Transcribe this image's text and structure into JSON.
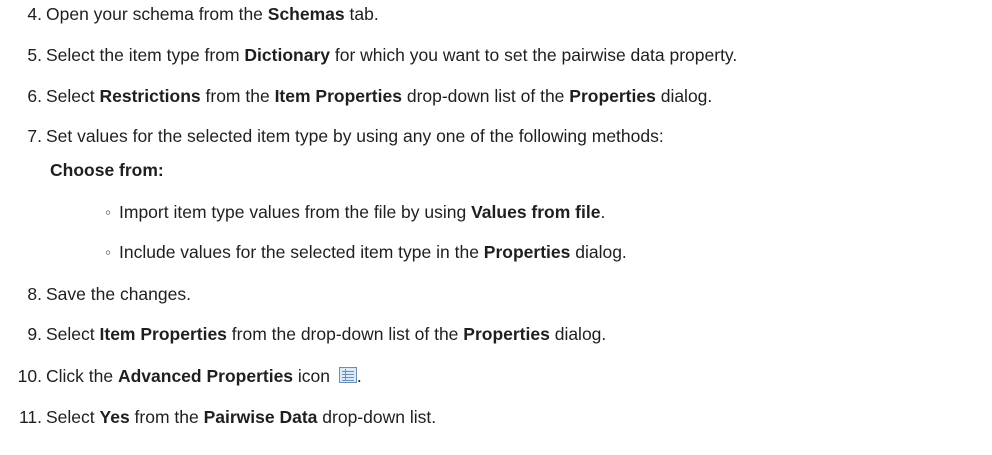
{
  "steps": [
    {
      "num": "4.",
      "t1": "Open your schema from the ",
      "b1": "Schemas",
      "t2": " tab."
    },
    {
      "num": "5.",
      "t1": "Select the item type from ",
      "b1": "Dictionary",
      "t2": " for which you want to set the pairwise data property."
    },
    {
      "num": "6.",
      "t1": "Select ",
      "b1": "Restrictions",
      "t2": " from the ",
      "b2": "Item Properties",
      "t3": " drop-down list of the ",
      "b3": "Properties",
      "t4": " dialog."
    },
    {
      "num": "7.",
      "t1": "Set values for the selected item type by using any one of the following methods:"
    },
    {
      "num": "8.",
      "t1": "Save the changes."
    },
    {
      "num": "9.",
      "t1": "Select ",
      "b1": "Item Properties",
      "t2": " from the drop-down list of the ",
      "b2": "Properties",
      "t3": " dialog."
    },
    {
      "num": "10.",
      "t1": "Click the ",
      "b1": "Advanced Properties",
      "t2": " icon ",
      "t3": "."
    },
    {
      "num": "11.",
      "t1": "Select ",
      "b1": "Yes",
      "t2": " from the ",
      "b2": "Pairwise Data",
      "t3": " drop-down list."
    }
  ],
  "choose_from": "Choose from:",
  "options": [
    {
      "bullet": "◦",
      "t1": "Import item type values from the file by using ",
      "b1": "Values from file",
      "t2": "."
    },
    {
      "bullet": "◦",
      "t1": "Include values for the selected item type in the ",
      "b1": "Properties",
      "t2": " dialog."
    }
  ],
  "icons": {
    "advanced_properties": "advanced-properties-icon"
  }
}
